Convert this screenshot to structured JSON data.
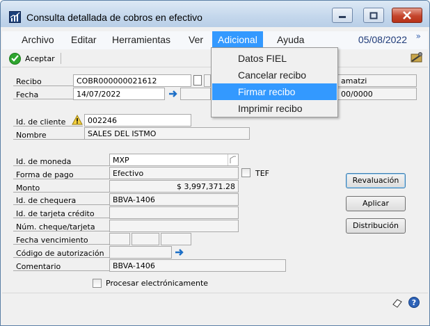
{
  "window": {
    "title": "Consulta detallada de cobros en efectivo"
  },
  "menu": {
    "items": [
      "Archivo",
      "Editar",
      "Herramientas",
      "Ver",
      "Adicional",
      "Ayuda"
    ],
    "active": "Adicional",
    "date": "05/08/2022",
    "overflow_glyph": "»"
  },
  "toolbar": {
    "accept_label": "Aceptar"
  },
  "adicional_menu": {
    "items": [
      "Datos FIEL",
      "Cancelar recibo",
      "Firmar recibo",
      "Imprimir recibo"
    ],
    "highlighted": "Firmar recibo"
  },
  "form": {
    "recibo_label": "Recibo",
    "recibo_value": "COBR000000021612",
    "fecha_label": "Fecha",
    "fecha_value": "14/07/2022",
    "right_partial_top": "amatzi",
    "right_partial_bottom": "00/0000",
    "cliente_label": "Id. de cliente",
    "cliente_value": "002246",
    "nombre_label": "Nombre",
    "nombre_value": "SALES DEL ISTMO",
    "moneda_label": "Id. de moneda",
    "moneda_value": "MXP",
    "forma_pago_label": "Forma de pago",
    "forma_pago_value": "Efectivo",
    "tef_label": "TEF",
    "monto_label": "Monto",
    "monto_value": "$ 3,997,371.28",
    "chequera_label": "Id. de chequera",
    "chequera_value": "BBVA-1406",
    "tarjeta_label": "Id. de tarjeta crédito",
    "tarjeta_value": "",
    "num_cheque_label": "Núm. cheque/tarjeta",
    "num_cheque_value": "",
    "vencimiento_label": "Fecha vencimiento",
    "autorizacion_label": "Código de autorización",
    "autorizacion_value": "",
    "comentario_label": "Comentario",
    "comentario_value": "BBVA-1406",
    "procesar_label": "Procesar electrónicamente"
  },
  "buttons": {
    "revaluacion": "Revaluación",
    "aplicar": "Aplicar",
    "distribucion": "Distribución"
  },
  "colors": {
    "menu_highlight": "#3399ff",
    "accept_green": "#2fa52f",
    "arrow_blue": "#1c6fc7"
  }
}
